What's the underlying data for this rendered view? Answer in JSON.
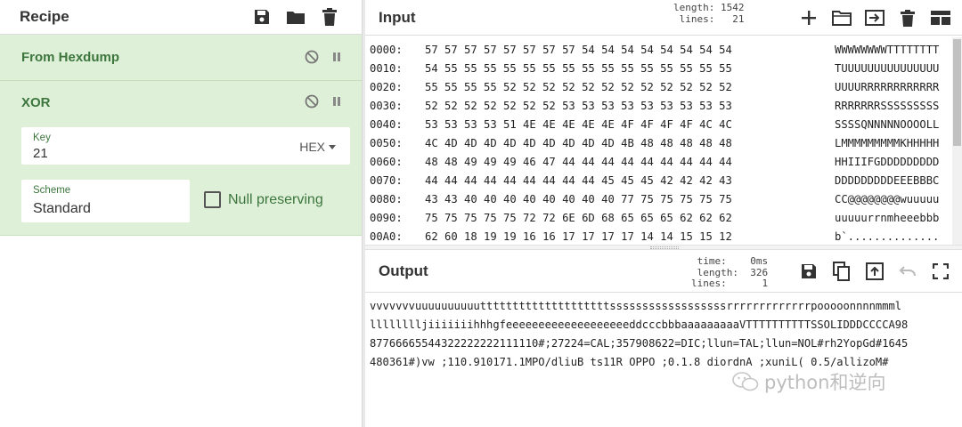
{
  "recipe": {
    "title": "Recipe",
    "icons": [
      "save-icon",
      "folder-icon",
      "trash-icon"
    ],
    "operations": {
      "from_hexdump": {
        "title": "From Hexdump"
      },
      "xor": {
        "title": "XOR",
        "key_label": "Key",
        "key_value": "21",
        "key_format": "HEX",
        "scheme_label": "Scheme",
        "scheme_value": "Standard",
        "null_preserving_label": "Null preserving",
        "null_preserving_checked": false
      }
    }
  },
  "input": {
    "title": "Input",
    "stats": {
      "length_label": "length:",
      "length_value": "1542",
      "lines_label": "lines:",
      "lines_value": "21"
    },
    "icons": [
      "plus-icon",
      "folder-icon",
      "import-icon",
      "trash-icon",
      "layout-icon"
    ],
    "lines": [
      {
        "addr": "0000:",
        "bytes": "57 57 57 57 57 57 57 57 54 54 54 54 54 54 54 54",
        "ascii": "WWWWWWWWTTTTTTTT"
      },
      {
        "addr": "0010:",
        "bytes": "54 55 55 55 55 55 55 55 55 55 55 55 55 55 55 55",
        "ascii": "TUUUUUUUUUUUUUUU"
      },
      {
        "addr": "0020:",
        "bytes": "55 55 55 55 52 52 52 52 52 52 52 52 52 52 52 52",
        "ascii": "UUUURRRRRRRRRRRR"
      },
      {
        "addr": "0030:",
        "bytes": "52 52 52 52 52 52 52 53 53 53 53 53 53 53 53 53",
        "ascii": "RRRRRRRSSSSSSSSS"
      },
      {
        "addr": "0040:",
        "bytes": "53 53 53 53 51 4E 4E 4E 4E 4E 4F 4F 4F 4F 4C 4C",
        "ascii": "SSSSQNNNNNOOOOLL"
      },
      {
        "addr": "0050:",
        "bytes": "4C 4D 4D 4D 4D 4D 4D 4D 4D 4D 4B 48 48 48 48 48",
        "ascii": "LMMMMMMMMMKHHHHH"
      },
      {
        "addr": "0060:",
        "bytes": "48 48 49 49 49 46 47 44 44 44 44 44 44 44 44 44",
        "ascii": "HHIIIFGDDDDDDDDD"
      },
      {
        "addr": "0070:",
        "bytes": "44 44 44 44 44 44 44 44 44 45 45 45 42 42 42 43",
        "ascii": "DDDDDDDDDEEEBBBC"
      },
      {
        "addr": "0080:",
        "bytes": "43 43 40 40 40 40 40 40 40 40 77 75 75 75 75 75",
        "ascii": "CC@@@@@@@@wuuuuu"
      },
      {
        "addr": "0090:",
        "bytes": "75 75 75 75 75 72 72 6E 6D 68 65 65 65 62 62 62",
        "ascii": "uuuuurrnmheeebbb"
      },
      {
        "addr": "00A0:",
        "bytes": "62 60 18 19 19 16 16 17 17 17 17 14 14 15 15 12",
        "ascii": "b`.............."
      }
    ]
  },
  "output": {
    "title": "Output",
    "stats": {
      "time_label": "time:",
      "time_value": "0ms",
      "length_label": "length:",
      "length_value": "326",
      "lines_label": "lines:",
      "lines_value": "1"
    },
    "icons": [
      "save-icon",
      "copy-icon",
      "replace-input-icon",
      "undo-icon",
      "fullscreen-icon"
    ],
    "lines": [
      "vvvvvvvuuuuuuuuuuttttttttttttttttttttssssssssssssssssssrrrrrrrrrrrrrpooooonnnnmmml",
      "lllllllljiiiiiiihhhgfeeeeeeeeeeeeeeeeeeeddcccbbbaaaaaaaaaVTTTTTTTTTTSSOLIDDDCCCCA98",
      "87766665544322222222111110#;27224=CAL;357908622=DIC;llun=TAL;llun=NOL#rh2YopGd#1645",
      "480361#)vw ;110.910171.1MPO/dliuB ts11R OPPO ;0.1.8 diordnA ;xuniL( 0.5/allizoM#"
    ]
  },
  "watermark": {
    "text": "python和逆向",
    "icon": "wechat-icon"
  }
}
